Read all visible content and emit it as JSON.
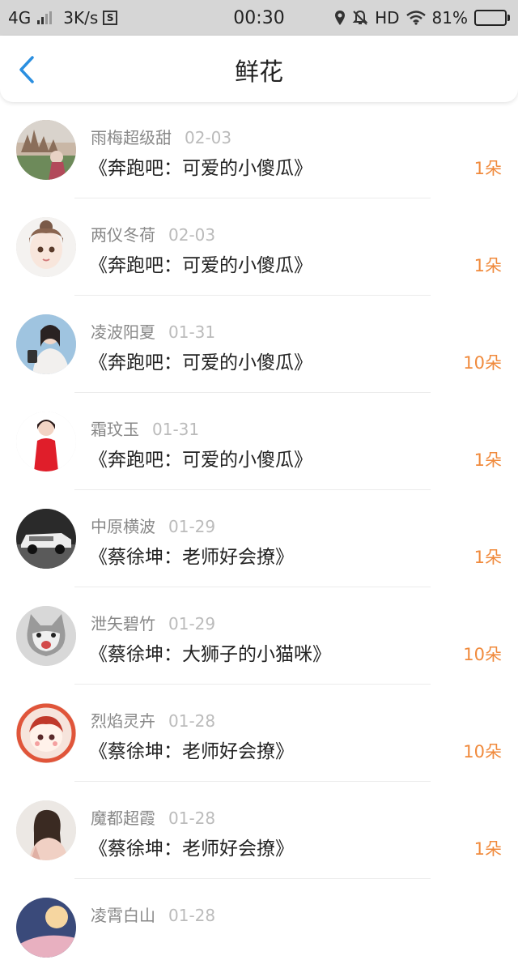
{
  "status_bar": {
    "network": "4G",
    "speed": "3K/s",
    "s_badge": "S",
    "time": "00:30",
    "hd": "HD",
    "battery_percent": "81%",
    "battery_level": 0.81,
    "icons": [
      "signal-icon",
      "location-icon",
      "mute-bell-icon",
      "wifi-icon",
      "battery-icon"
    ]
  },
  "nav": {
    "title": "鲜花",
    "back_icon": "chevron-left-icon",
    "accent_color": "#2b8fe0"
  },
  "colors": {
    "name": "#888888",
    "date": "#bbbbbb",
    "book": "#222222",
    "count": "#f08a3c"
  },
  "items": [
    {
      "name": "雨梅超级甜",
      "date": "02-03",
      "book": "《奔跑吧：可爱的小傻瓜》",
      "count": "1朵"
    },
    {
      "name": "两仪冬荷",
      "date": "02-03",
      "book": "《奔跑吧：可爱的小傻瓜》",
      "count": "1朵"
    },
    {
      "name": "凌波阳夏",
      "date": "01-31",
      "book": "《奔跑吧：可爱的小傻瓜》",
      "count": "10朵"
    },
    {
      "name": "霜玟玉",
      "date": "01-31",
      "book": "《奔跑吧：可爱的小傻瓜》",
      "count": "1朵"
    },
    {
      "name": "中原横波",
      "date": "01-29",
      "book": "《蔡徐坤：老师好会撩》",
      "count": "1朵"
    },
    {
      "name": "泄矢碧竹",
      "date": "01-29",
      "book": "《蔡徐坤：大狮子的小猫咪》",
      "count": "10朵"
    },
    {
      "name": "烈焰灵卉",
      "date": "01-28",
      "book": "《蔡徐坤：老师好会撩》",
      "count": "10朵"
    },
    {
      "name": "魔都超霞",
      "date": "01-28",
      "book": "《蔡徐坤：老师好会撩》",
      "count": "1朵"
    },
    {
      "name": "凌霄白山",
      "date": "01-28",
      "book": "",
      "count": ""
    }
  ]
}
